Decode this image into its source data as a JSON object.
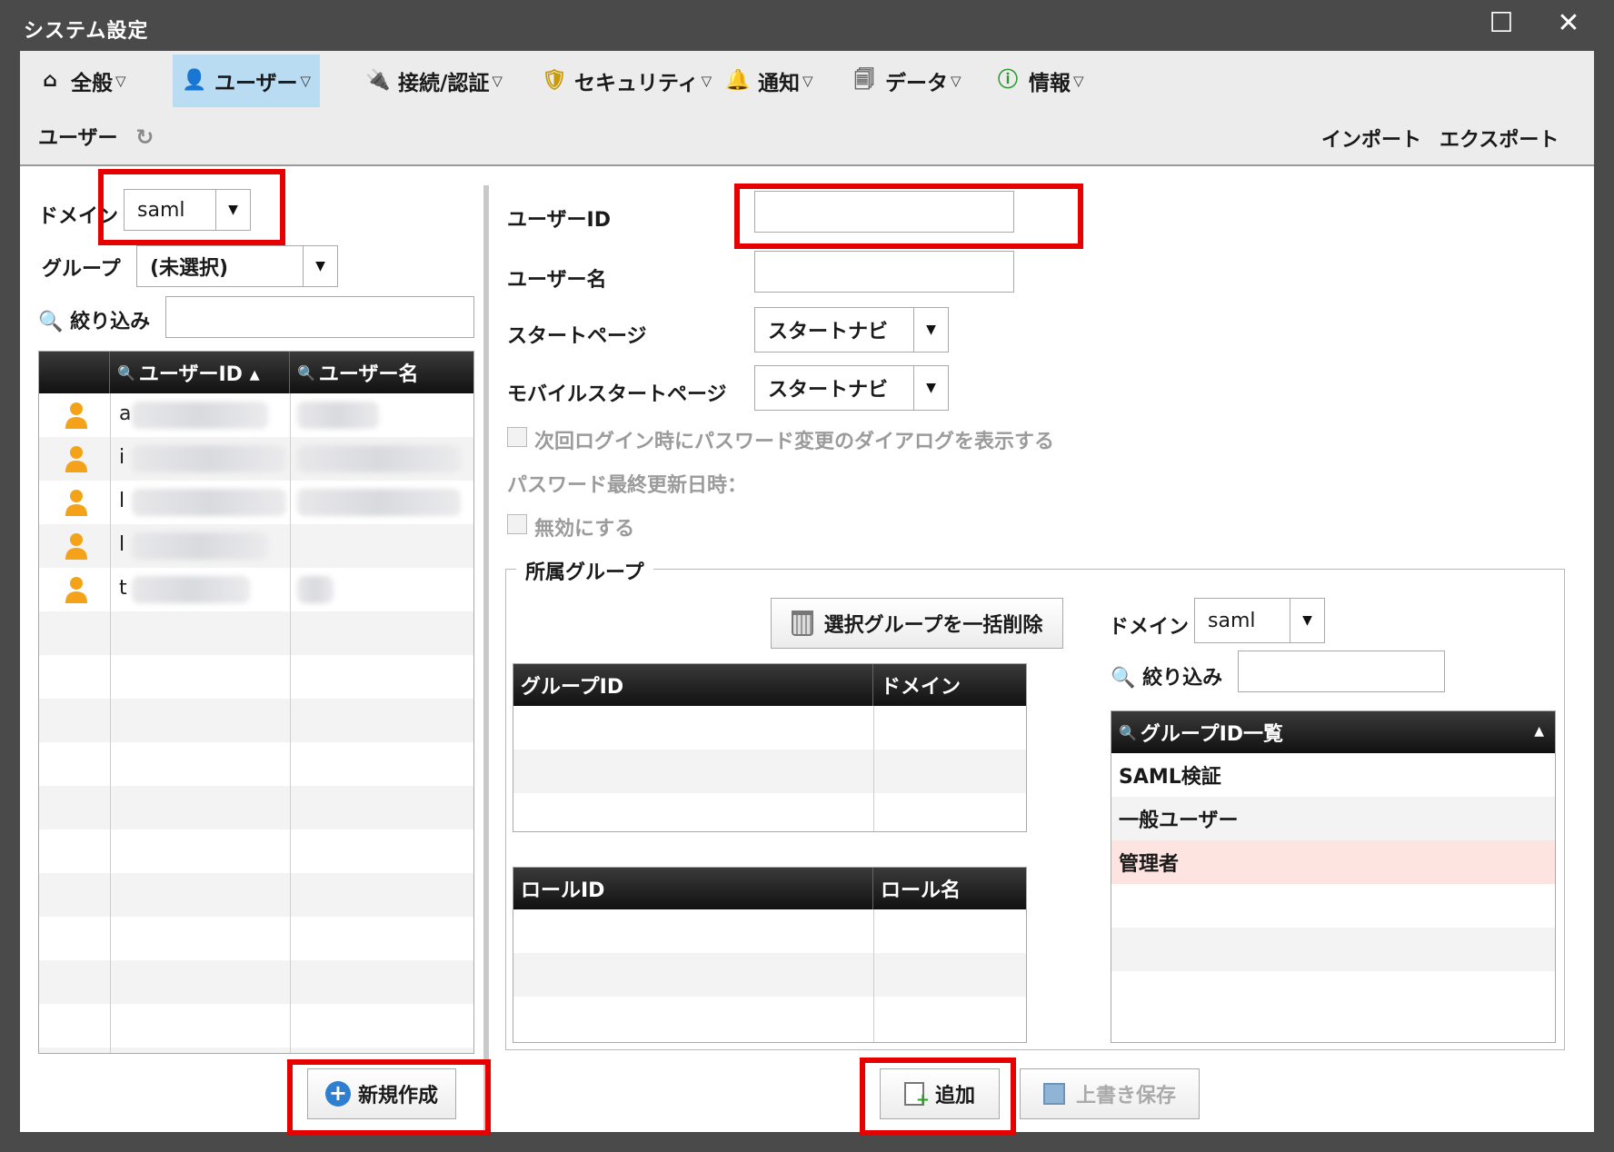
{
  "window": {
    "title": "システム設定",
    "maximize_icon": "maximize-icon",
    "close_icon": "close-icon",
    "maximize_glyph": "☐",
    "close_glyph": "✕"
  },
  "menu": [
    {
      "label": "全般",
      "icon": "home-icon",
      "glyph": "⌂",
      "active": false
    },
    {
      "label": "ユーザー",
      "icon": "user-icon",
      "glyph": "👤",
      "active": true
    },
    {
      "label": "接続/認証",
      "icon": "plug-icon",
      "glyph": "🔌",
      "active": false
    },
    {
      "label": "セキュリティ",
      "icon": "shield-icon",
      "glyph": "🛡",
      "active": false
    },
    {
      "label": "通知",
      "icon": "bell-icon",
      "glyph": "🔔",
      "active": false
    },
    {
      "label": "データ",
      "icon": "documents-icon",
      "glyph": "🗐",
      "active": false
    },
    {
      "label": "情報",
      "icon": "info-icon",
      "glyph": "ⓘ",
      "active": false
    }
  ],
  "menu_dropdown_glyph": "▽",
  "subbar": {
    "title": "ユーザー",
    "refresh_glyph": "↻",
    "import": "インポート",
    "export": "エクスポート"
  },
  "left": {
    "domain_label": "ドメイン",
    "domain_value": "saml",
    "group_label": "グループ",
    "group_value": "(未選択)",
    "filter_label": "絞り込み",
    "filter_value": "",
    "columns": [
      "ユーザーID ▴",
      "ユーザー名"
    ],
    "column_search_glyph": "🔍",
    "rows": [
      {
        "id_initial": "a"
      },
      {
        "id_initial": "i"
      },
      {
        "id_initial": "l"
      },
      {
        "id_initial": "l"
      },
      {
        "id_initial": "t"
      }
    ],
    "new_button": "新規作成"
  },
  "form": {
    "user_id_label": "ユーザーID",
    "user_id_value": "",
    "user_name_label": "ユーザー名",
    "user_name_value": "",
    "start_page_label": "スタートページ",
    "start_page_value": "スタートナビ",
    "mobile_start_label": "モバイルスタートページ",
    "mobile_start_value": "スタートナビ",
    "pw_dialog_label": "次回ログイン時にパスワード変更のダイアログを表示する",
    "pw_updated_label": "パスワード最終更新日時：",
    "disable_label": "無効にする"
  },
  "groups": {
    "legend": "所属グループ",
    "bulk_delete": "選択グループを一括削除",
    "group_table_cols": [
      "グループID",
      "ドメイン"
    ],
    "role_table_cols": [
      "ロールID",
      "ロール名"
    ],
    "domain_label": "ドメイン",
    "domain_value": "saml",
    "filter_label": "絞り込み",
    "filter_value": "",
    "list_header": "グループID一覧",
    "list_sort_glyph": "▲",
    "list_items": [
      "SAML検証",
      "一般ユーザー",
      "管理者"
    ],
    "selected_color": "#fde4e0"
  },
  "buttons": {
    "add": "追加",
    "save": "上書き保存"
  },
  "highlight_color": "#e60000"
}
